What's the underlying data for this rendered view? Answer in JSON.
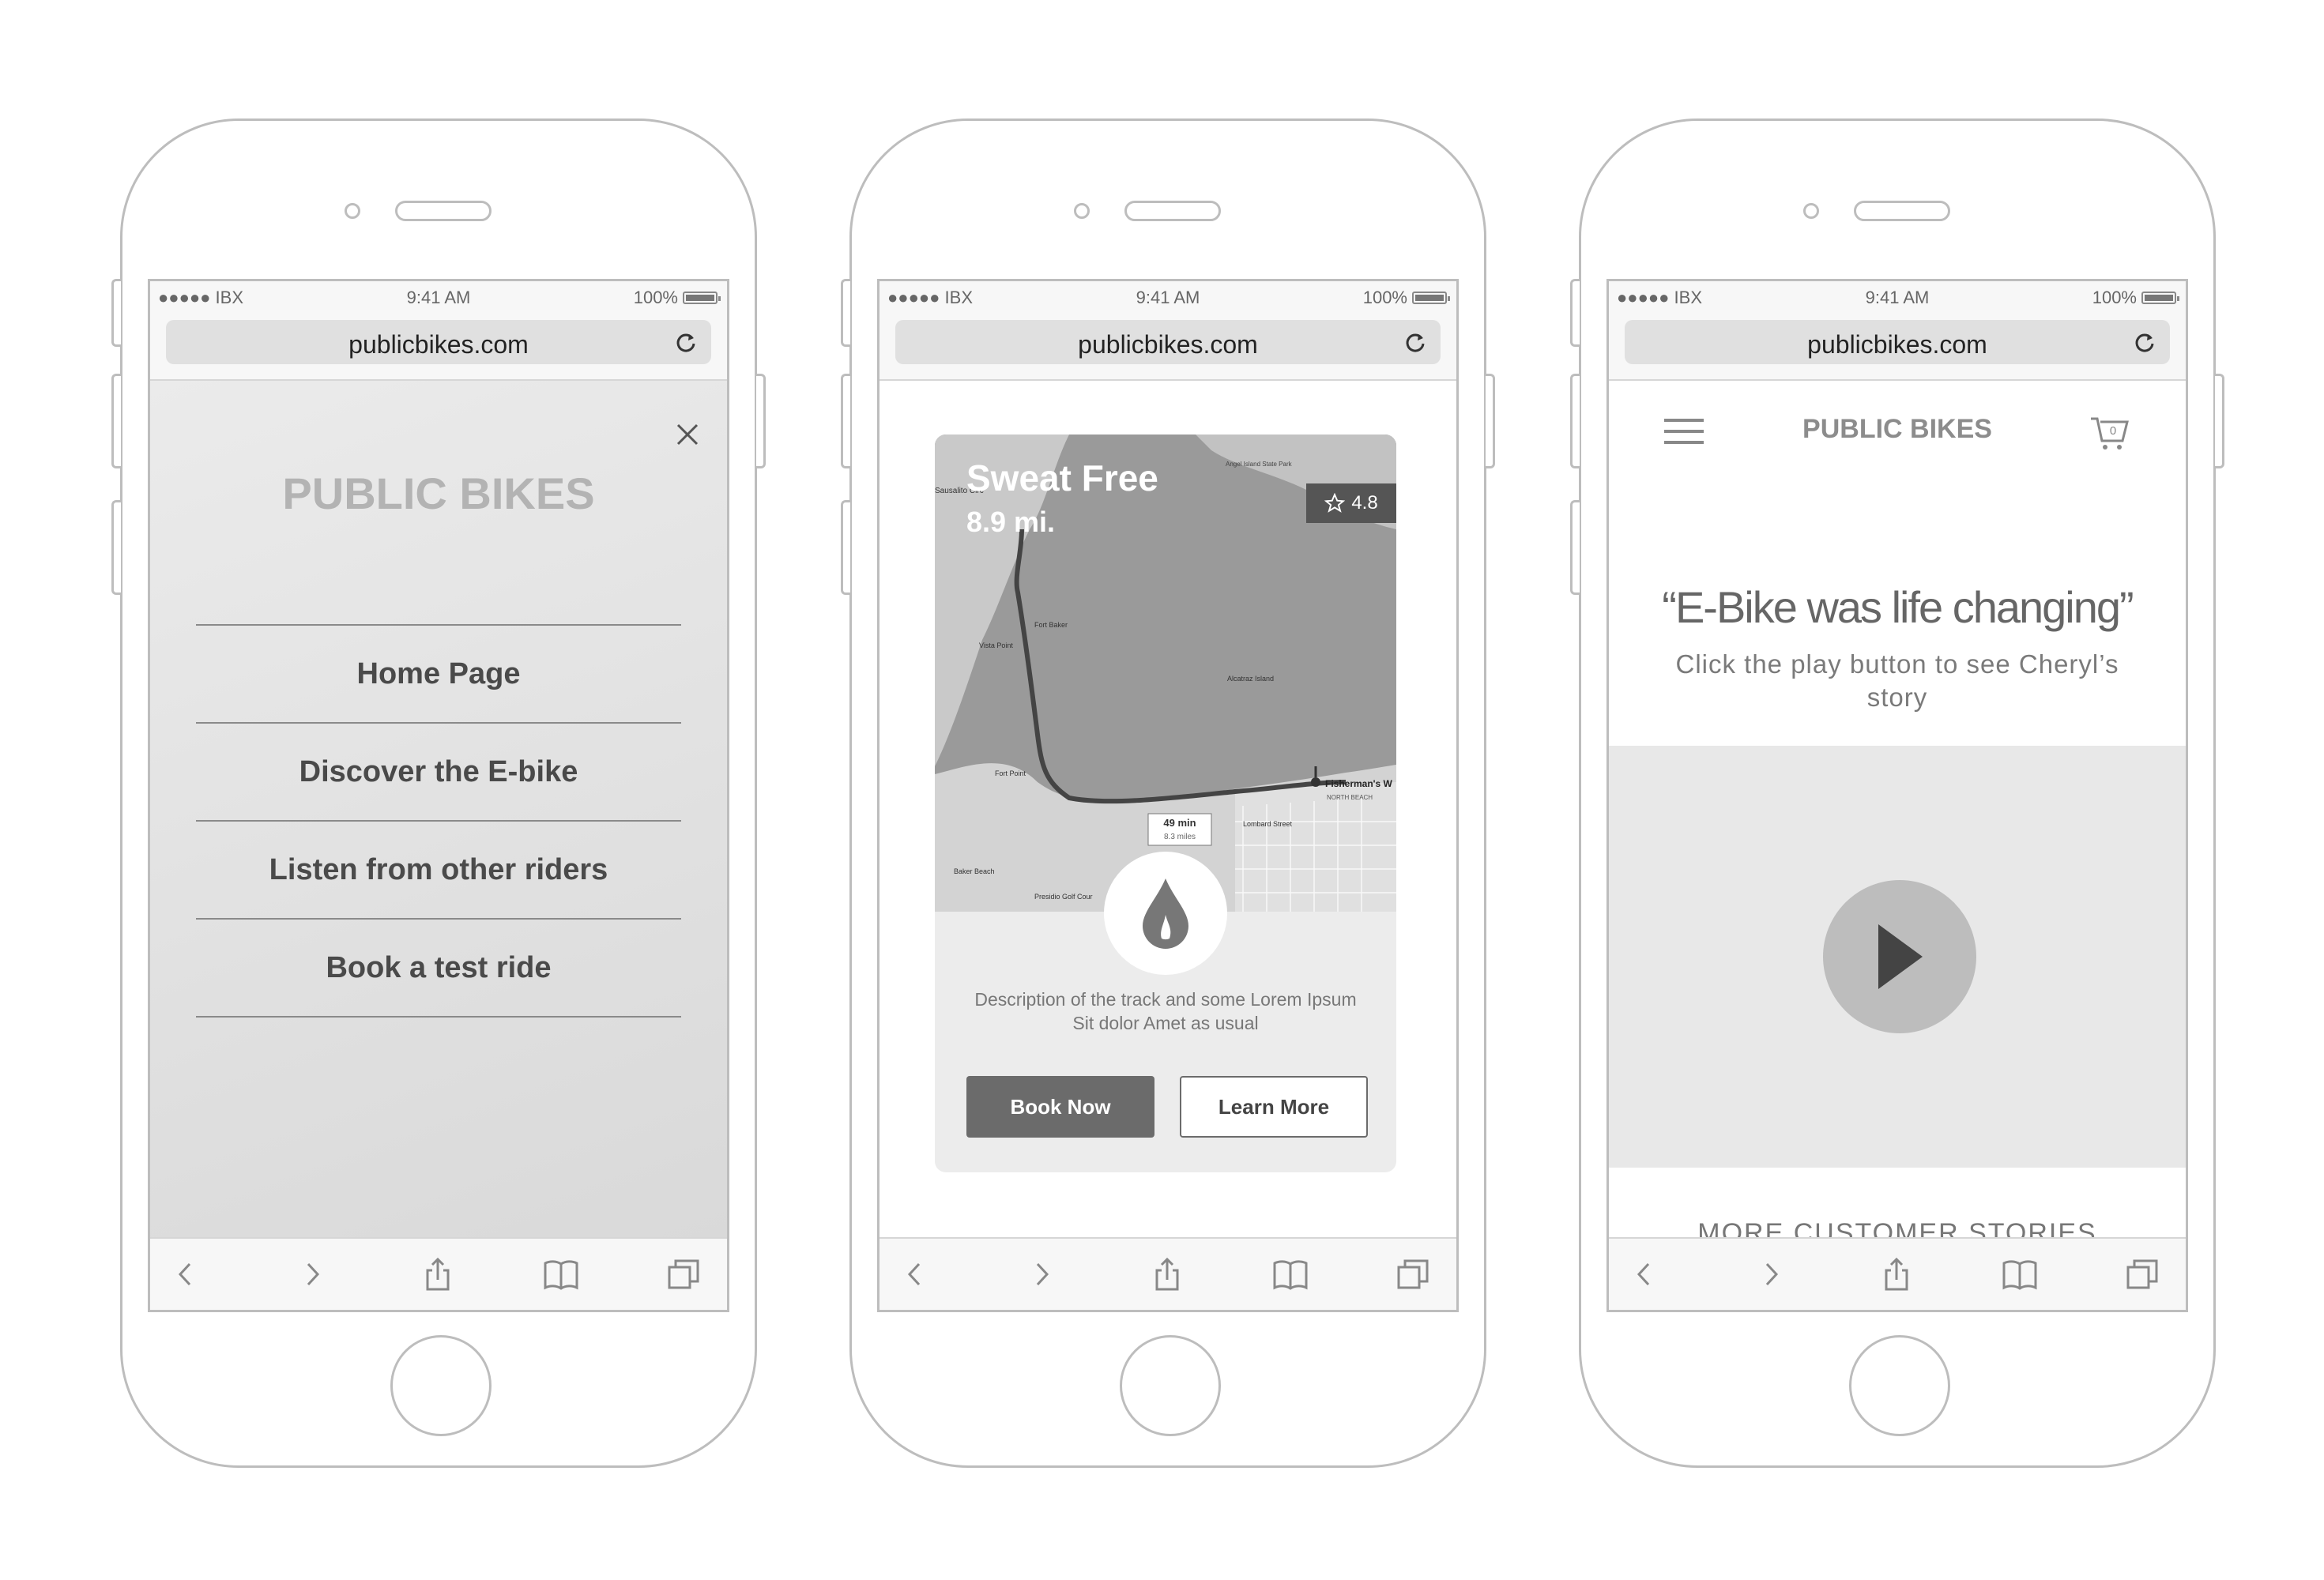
{
  "status_bar": {
    "carrier": "●●●●● IBX",
    "time": "9:41 AM",
    "battery": "100%"
  },
  "browser": {
    "url": "publicbikes.com"
  },
  "phone1": {
    "brand": "PUBLIC BIKES",
    "menu_items": [
      "Home Page",
      "Discover the E-bike",
      "Listen from other riders",
      "Book a test ride"
    ]
  },
  "phone2": {
    "title": "Sweat Free",
    "distance": "8.9 mi.",
    "rating": "4.8",
    "map_labels": {
      "badge_time": "49 min",
      "badge_dist": "8.3 miles",
      "fishermans": "Fisherman's W",
      "fort_baker": "Fort Baker",
      "vista": "Vista Point",
      "alcatraz": "Alcatraz Island",
      "fort_point": "Fort Point",
      "baker_beach": "Baker Beach",
      "presidio": "Presidio Golf Cour",
      "angel": "Angel Island State Park",
      "lombard": "Lombard Street",
      "north_beach": "NORTH BEACH",
      "sausalito": "Sausalito Circ"
    },
    "description": "Description of the track and some Lorem Ipsum Sit dolor Amet as usual",
    "book_label": "Book Now",
    "learn_label": "Learn More"
  },
  "phone3": {
    "brand": "PUBLIC BIKES",
    "cart_count": "0",
    "quote": "“E-Bike was life changing”",
    "subtitle": "Click the play button to see Cheryl’s story",
    "more_stories": "MORE CUSTOMER STORIES"
  },
  "icons": {
    "toolbar": [
      "back-icon",
      "forward-icon",
      "share-icon",
      "bookmarks-icon",
      "tabs-icon"
    ]
  }
}
